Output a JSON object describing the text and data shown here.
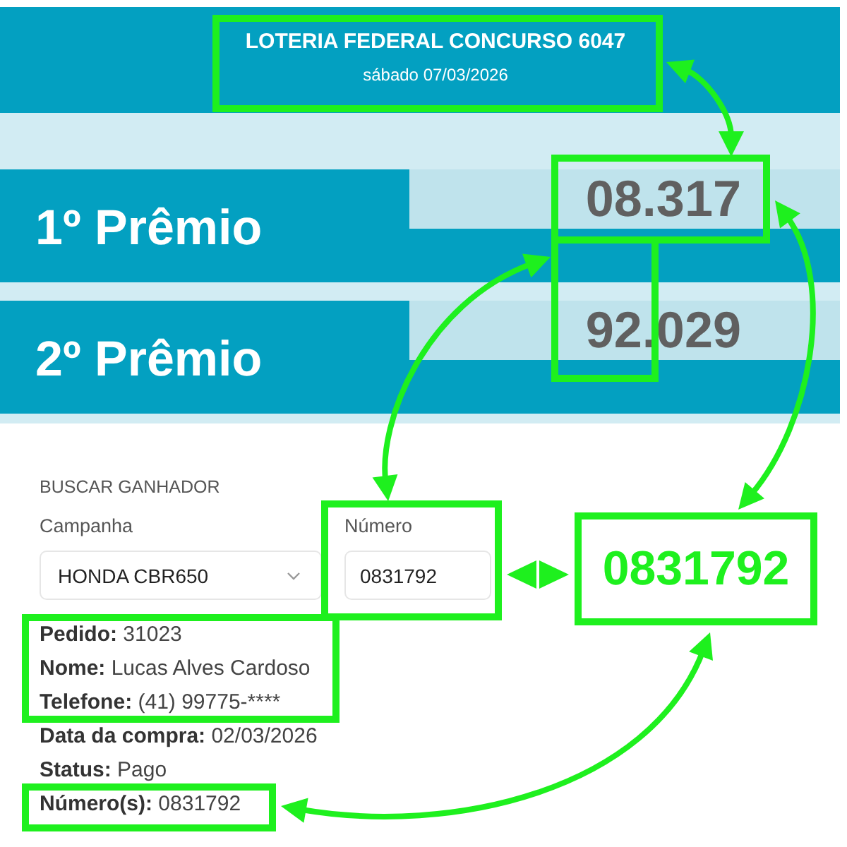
{
  "header": {
    "title": "LOTERIA FEDERAL CONCURSO 6047",
    "date": "sábado 07/03/2026"
  },
  "prizes": [
    {
      "label": "1º Prêmio",
      "number": "08.317"
    },
    {
      "label": "2º Prêmio",
      "number": "92.029"
    }
  ],
  "search": {
    "heading": "BUSCAR GANHADOR",
    "fields": [
      {
        "kind": "select",
        "label": "Campanha",
        "value": "HONDA CBR650"
      },
      {
        "kind": "input",
        "label": "Número",
        "value": "0831792"
      }
    ]
  },
  "winner": {
    "lines": [
      {
        "label": "Pedido:",
        "value": "31023"
      },
      {
        "label": "Nome:",
        "value": "Lucas Alves Cardoso"
      },
      {
        "label": "Telefone:",
        "value": "(41) 99775-****"
      },
      {
        "label": "Data da compra:",
        "value": "02/03/2026"
      },
      {
        "label": "Status:",
        "value": "Pago"
      },
      {
        "label": "Número(s):",
        "value": "0831792"
      }
    ]
  },
  "annotation": {
    "callout": "0831792"
  }
}
